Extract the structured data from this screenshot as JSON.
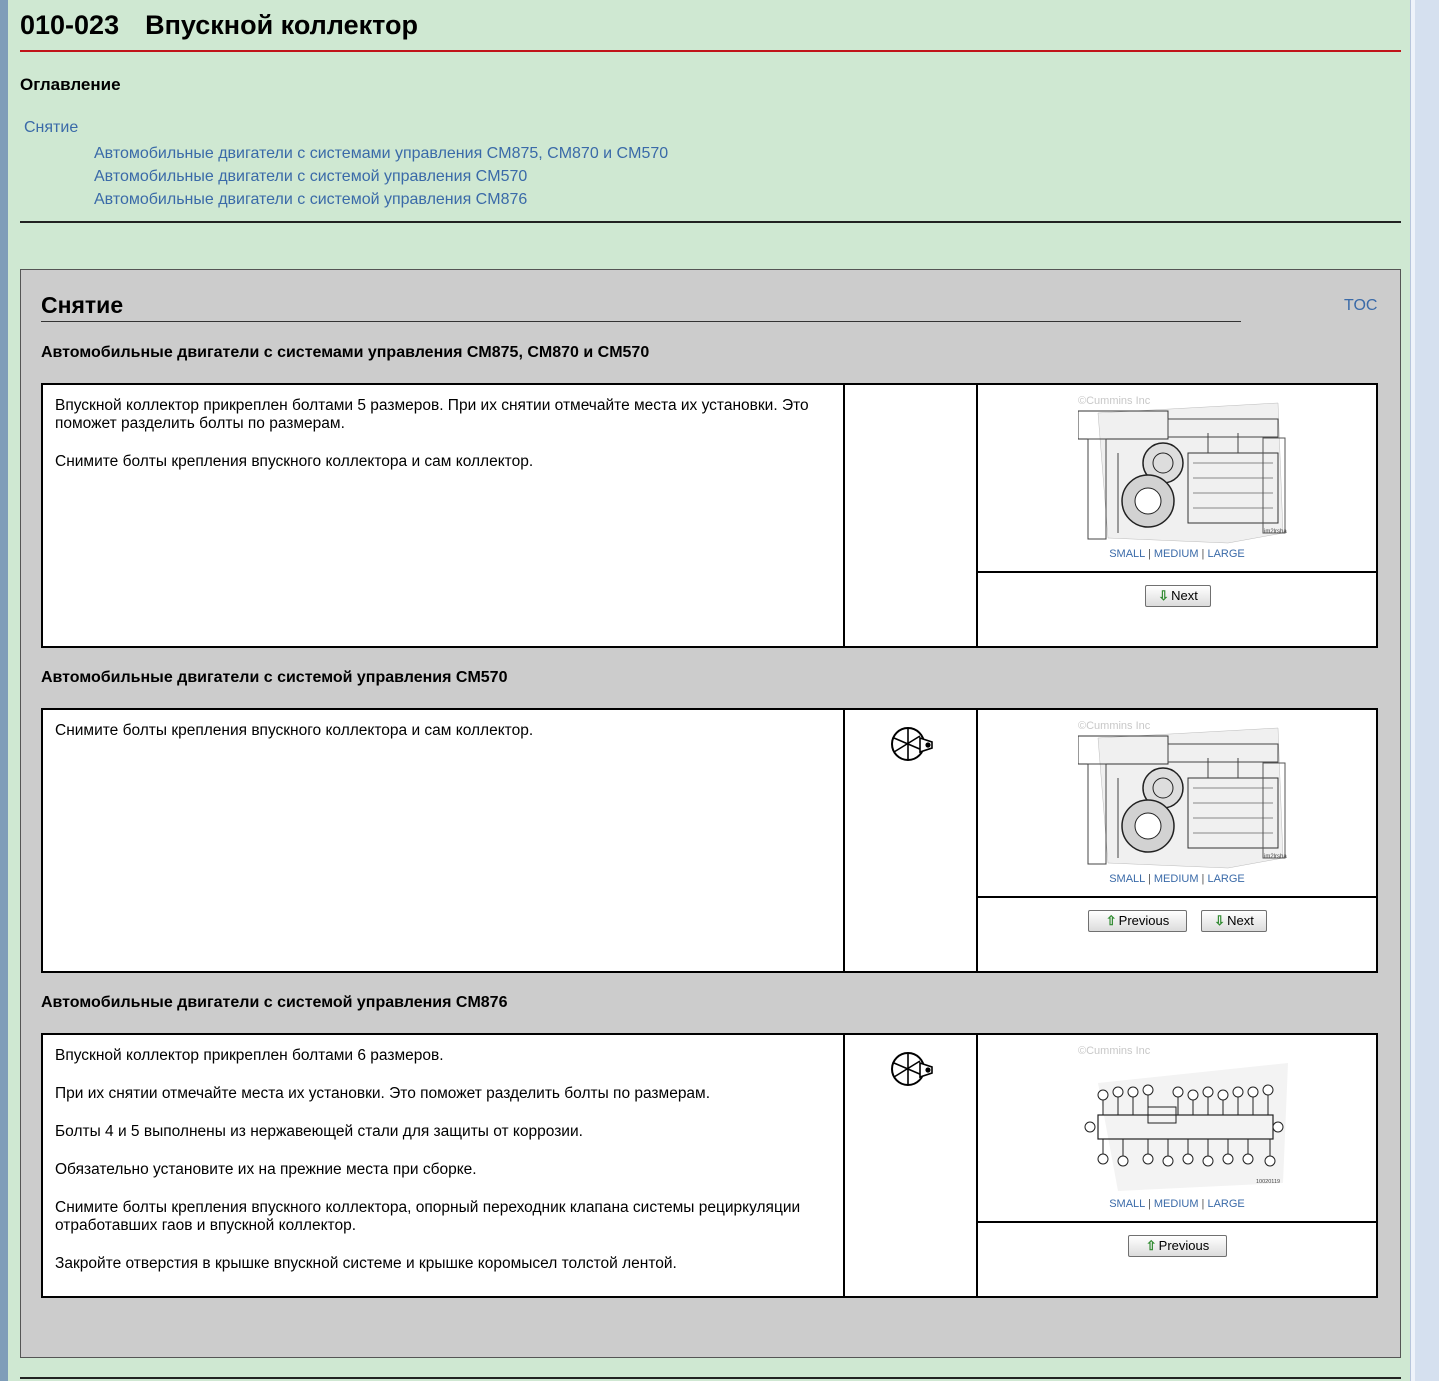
{
  "document": {
    "code": "010-023",
    "title": "Впускной коллектор"
  },
  "toc": {
    "heading": "Оглавление",
    "section": "Снятие",
    "items": [
      "Автомобильные двигатели с системами управления CM875, CM870 и CM570",
      "Автомобильные двигатели с системой управления CM570",
      "Автомобильные двигатели с системой управления CM876"
    ]
  },
  "section": {
    "title": "Снятие",
    "toc_link": "TOC"
  },
  "steps": [
    {
      "heading": "Автомобильные двигатели с системами управления CM875, CM870 и CM570",
      "paragraphs": [
        "Впускной коллектор прикреплен болтами 5 размеров. При их снятии отмечайте места их установки. Это поможет разделить болты по размерам.",
        "Снимите болты крепления впускного коллектора и сам коллектор."
      ],
      "has_tool_icon": false,
      "image": {
        "copyright": "©Cummins Inc",
        "caption": "im2lrsha"
      },
      "buttons": {
        "next": "Next"
      }
    },
    {
      "heading": "Автомобильные двигатели с системой управления CM570",
      "paragraphs": [
        "Снимите болты крепления впускного коллектора и сам коллектор."
      ],
      "has_tool_icon": true,
      "image": {
        "copyright": "©Cummins Inc",
        "caption": "im2lrsha"
      },
      "buttons": {
        "previous": "Previous",
        "next": "Next"
      }
    },
    {
      "heading": "Автомобильные двигатели с системой управления CM876",
      "paragraphs": [
        "Впускной коллектор прикреплен болтами 6 размеров.",
        "При их снятии отмечайте места их установки. Это поможет разделить болты по размерам.",
        "Болты 4 и 5 выполнены из нержавеющей стали для защиты от коррозии.",
        "Обязательно установите их на прежние места при сборке.",
        "Снимите болты крепления впускного коллектора, опорный переходник клапана системы рециркуляции отработавших гаов и впускной коллектор.",
        "Закройте отверстия в крышке впускной системе и крышке коромысел толстой лентой."
      ],
      "has_tool_icon": true,
      "image": {
        "copyright": "©Cummins Inc",
        "caption": "10020119"
      },
      "buttons": {
        "previous": "Previous"
      }
    }
  ],
  "image_size_links": {
    "small": "SMALL",
    "medium": "MEDIUM",
    "large": "LARGE",
    "separator": "|"
  },
  "colors": {
    "page_bg": "#cfe8d2",
    "section_bg": "#cccccc",
    "link": "#3a6aa8",
    "title_rule": "#c0141a"
  },
  "icons": {
    "tool": "wrench-socket-icon",
    "arrow_down": "green-arrow-down-icon",
    "arrow_up": "green-arrow-up-icon"
  }
}
